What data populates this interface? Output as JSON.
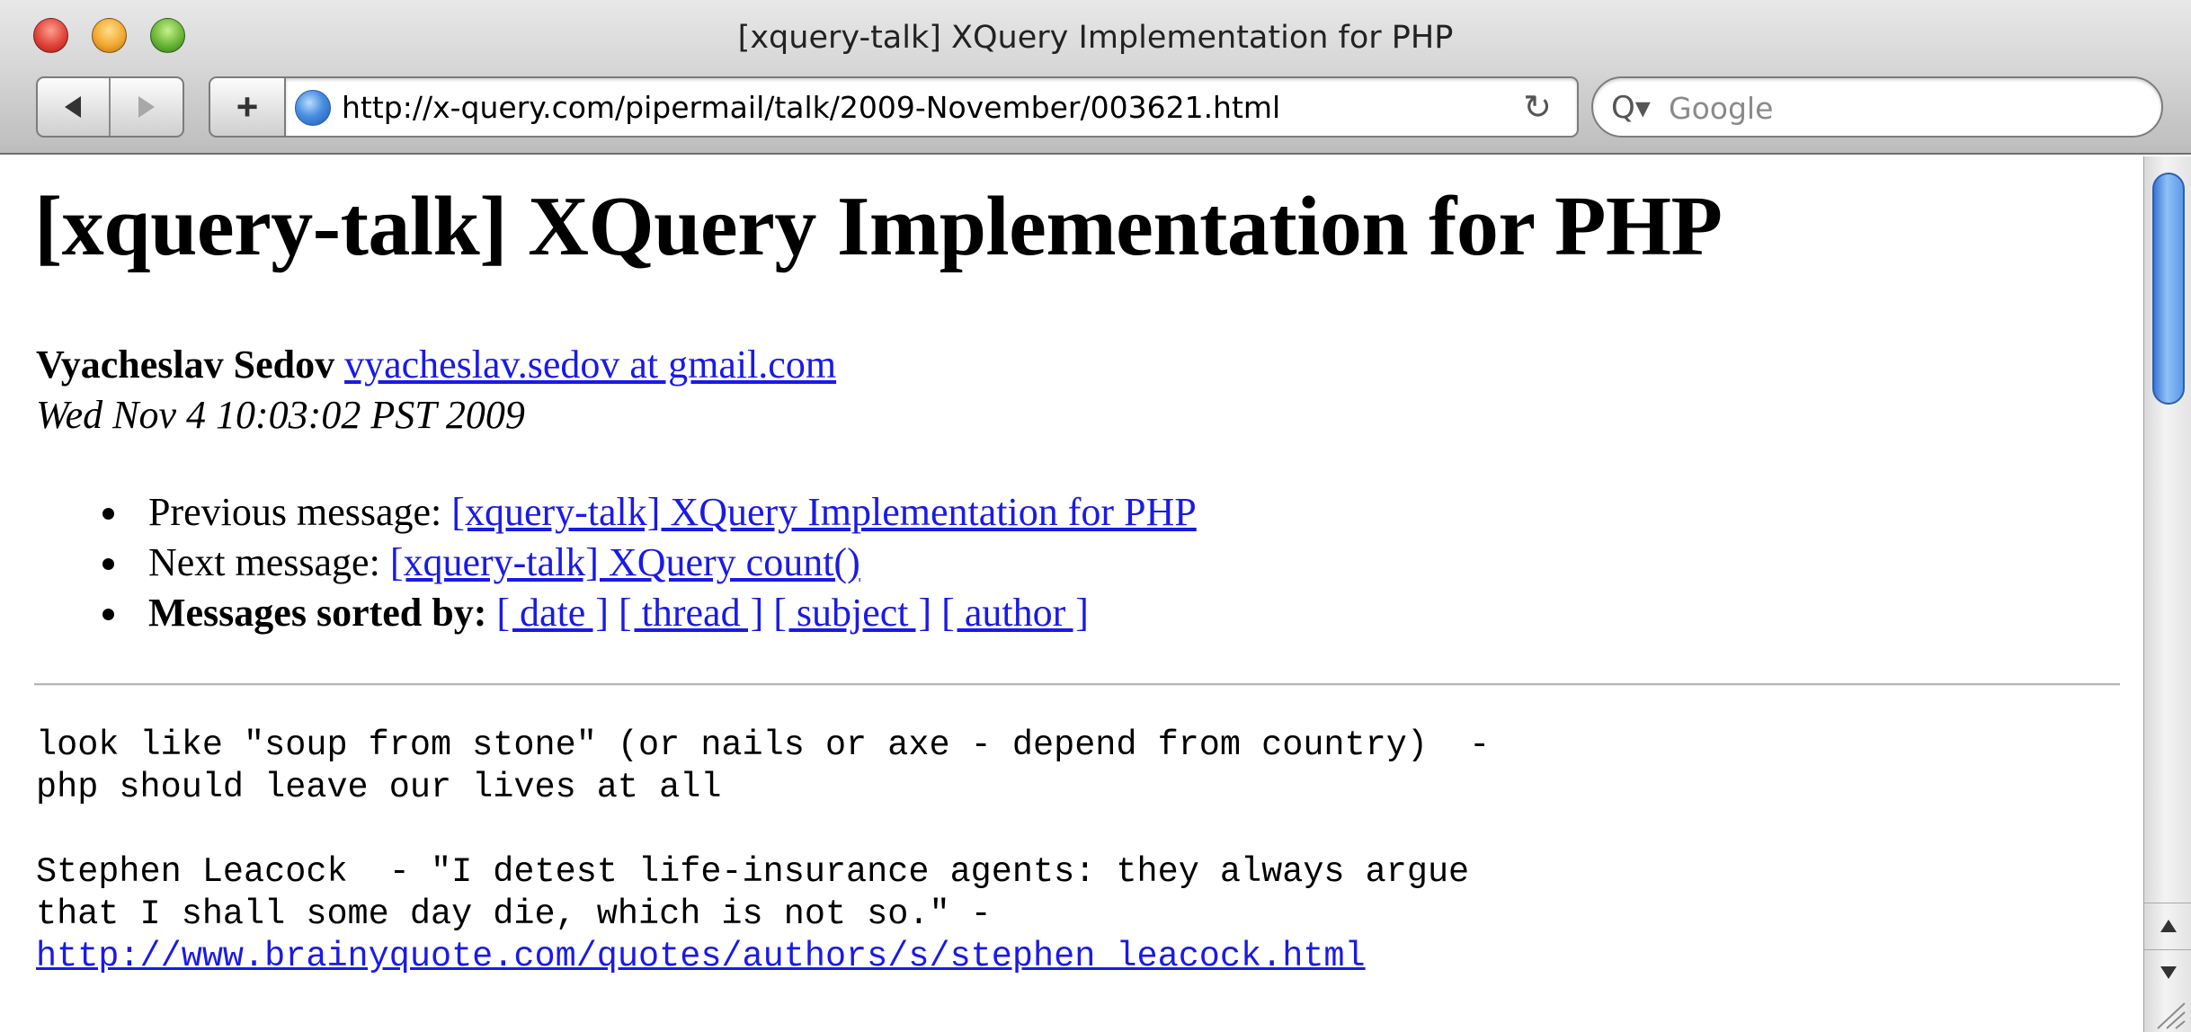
{
  "window": {
    "title": "[xquery-talk] XQuery Implementation for PHP"
  },
  "toolbar": {
    "add_label": "+",
    "address": "http://x-query.com/pipermail/talk/2009-November/003621.html",
    "reload_glyph": "↻",
    "search_glyph": "Q▾",
    "search_placeholder": "Google"
  },
  "page": {
    "title": "[xquery-talk] XQuery Implementation for PHP",
    "author_name": "Vyacheslav Sedov",
    "author_email": "vyacheslav.sedov at gmail.com ",
    "date": "Wed Nov 4 10:03:02 PST 2009",
    "nav": {
      "previous_label": "Previous message: ",
      "previous_link": "[xquery-talk] XQuery Implementation for PHP",
      "next_label": "Next message: ",
      "next_link": "[xquery-talk] XQuery count()",
      "sorted_label": "Messages sorted by:",
      "sort_date": "[ date ]",
      "sort_thread": "[ thread ]",
      "sort_subject": "[ subject ]",
      "sort_author": "[ author ]"
    },
    "body": {
      "line1": "look like \"soup from stone\" (or nails or axe - depend from country)  -",
      "line2": "php should leave our lives at all",
      "line3": "Stephen Leacock  - \"I detest life-insurance agents: they always argue",
      "line4": "that I shall some day die, which is not so.\" -",
      "link": "http://www.brainyquote.com/quotes/authors/s/stephen_leacock.html"
    }
  },
  "colors": {
    "link": "#1a1ae6",
    "scroll_thumb": "#5b99e8"
  },
  "icons": {
    "close": "close-button",
    "minimize": "minimize-button",
    "zoom": "zoom-button",
    "back": "back-arrow-icon",
    "forward": "forward-arrow-icon",
    "site": "globe-icon",
    "reload": "reload-icon",
    "search": "search-icon"
  }
}
